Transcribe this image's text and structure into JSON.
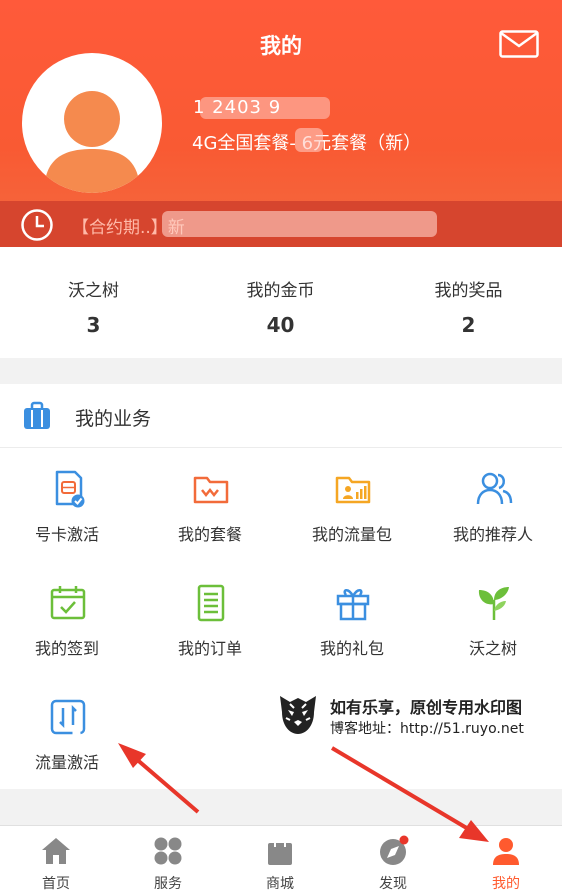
{
  "header": {
    "title": "我的",
    "phone": "1         2403  9",
    "plan": "4G全国套餐-  6元套餐（新）",
    "contract": "【合约期..】新"
  },
  "stats": [
    {
      "label": "沃之树",
      "value": "3"
    },
    {
      "label": "我的金币",
      "value": "40"
    },
    {
      "label": "我的奖品",
      "value": "2"
    }
  ],
  "business": {
    "title": "我的业务",
    "items": [
      {
        "label": "号卡激活",
        "icon": "sim-card-icon",
        "color": "#3b8fe0"
      },
      {
        "label": "我的套餐",
        "icon": "folder-wave-icon",
        "color": "#f26b3a"
      },
      {
        "label": "我的流量包",
        "icon": "folder-chart-icon",
        "color": "#f5a623"
      },
      {
        "label": "我的推荐人",
        "icon": "users-icon",
        "color": "#3b8fe0"
      },
      {
        "label": "我的签到",
        "icon": "calendar-check-icon",
        "color": "#6cbf3a"
      },
      {
        "label": "我的订单",
        "icon": "order-list-icon",
        "color": "#6cbf3a"
      },
      {
        "label": "我的礼包",
        "icon": "gift-icon",
        "color": "#3b8fe0"
      },
      {
        "label": "沃之树",
        "icon": "sprout-icon",
        "color": "#6cbf3a"
      },
      {
        "label": "流量激活",
        "icon": "data-activate-icon",
        "color": "#3b8fe0"
      }
    ]
  },
  "watermark": {
    "line1": "如有乐享，原创专用水印图",
    "line2": "博客地址：http://51.ruyo.net"
  },
  "tabs": [
    {
      "label": "首页",
      "icon": "home-icon"
    },
    {
      "label": "服务",
      "icon": "grid-icon"
    },
    {
      "label": "商城",
      "icon": "shopping-bag-icon"
    },
    {
      "label": "发现",
      "icon": "compass-icon"
    },
    {
      "label": "我的",
      "icon": "user-icon"
    }
  ],
  "colors": {
    "header": "#f95a33",
    "accent": "#ff5a2e",
    "arrow": "#e8362a"
  }
}
